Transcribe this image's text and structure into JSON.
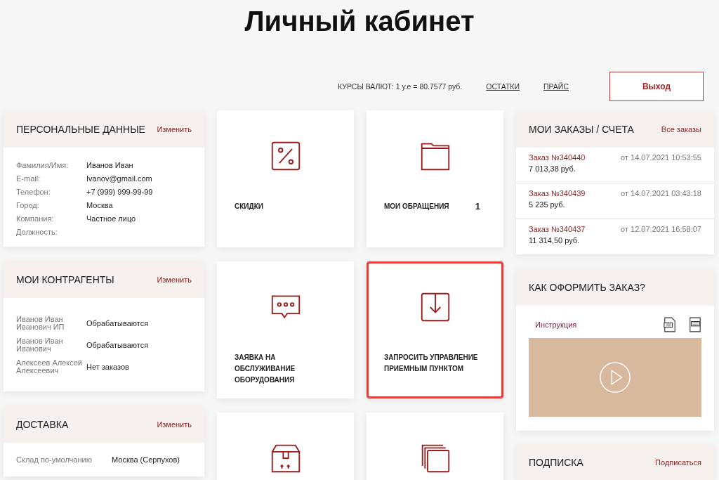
{
  "page_title": "Личный кабинет",
  "topbar": {
    "rates": "КУРСЫ ВАЛЮТ: 1 у.е = 80.7577 руб.",
    "links": [
      "ОСТАТКИ",
      "ПРАЙС"
    ],
    "logout": "Выход"
  },
  "personal": {
    "title": "ПЕРСОНАЛЬНЫЕ ДАННЫЕ",
    "action": "Изменить",
    "fields": [
      {
        "label": "Фамилия/Имя:",
        "value": "Иванов Иван"
      },
      {
        "label": "E-mail:",
        "value": "Ivanov@gmail.com"
      },
      {
        "label": "Телефон:",
        "value": "+7 (999) 999-99-99"
      },
      {
        "label": "Город:",
        "value": "Москва"
      },
      {
        "label": "Компания:",
        "value": "Частное лицо"
      },
      {
        "label": "Должность:"
      }
    ]
  },
  "contractors": {
    "title": "МОИ КОНТРАГЕНТЫ",
    "action": "Изменить",
    "rows": [
      {
        "name": "Иванов Иван Иванович ИП",
        "status": "Обрабатываются"
      },
      {
        "name": "Иванов Иван Иванович",
        "status": "Обрабатываются"
      },
      {
        "name": "Алексеев Алексей Алексеевич",
        "status": "Нет заказов"
      }
    ]
  },
  "delivery": {
    "title": "ДОСТАВКА",
    "action": "Изменить",
    "rows": [
      {
        "label": "Склад по-умолчанию",
        "value": "Москва (Серпухов)"
      }
    ]
  },
  "tiles": [
    {
      "kind": "percent",
      "label": "СКИДКИ",
      "selected": false
    },
    {
      "kind": "folder",
      "label": "МОИ ОБРАЩЕНИЯ",
      "count": "1",
      "selected": false
    },
    {
      "kind": "chat",
      "label": "ЗАЯВКА НА ОБСЛУЖИВАНИЕ ОБОРУДОВАНИЯ",
      "selected": false
    },
    {
      "kind": "download",
      "label": "ЗАПРОСИТЬ УПРАВЛЕНИЕ ПРИЕМНЫМ ПУНКТОМ",
      "selected": true
    },
    {
      "kind": "box",
      "selected": false
    },
    {
      "kind": "stack",
      "selected": false
    }
  ],
  "orders": {
    "title": "МОИ ЗАКАЗЫ / СЧЕТА",
    "action": "Все заказы",
    "items": [
      {
        "number": "Заказ №340440",
        "date": "от 14.07.2021 10:53:55",
        "amount": "7 013,38 руб."
      },
      {
        "number": "Заказ №340439",
        "date": "от 14.07.2021 03:43:18",
        "amount": "5 235 руб."
      },
      {
        "number": "Заказ №340437",
        "date": "от 12.07.2021 16:58:07",
        "amount": "11 314,50 руб."
      }
    ]
  },
  "howto": {
    "title": "КАК ОФОРМИТЬ ЗАКАЗ?",
    "link": "Инструкция"
  },
  "subscription": {
    "title": "ПОДПИСКА",
    "action": "Подписаться"
  }
}
